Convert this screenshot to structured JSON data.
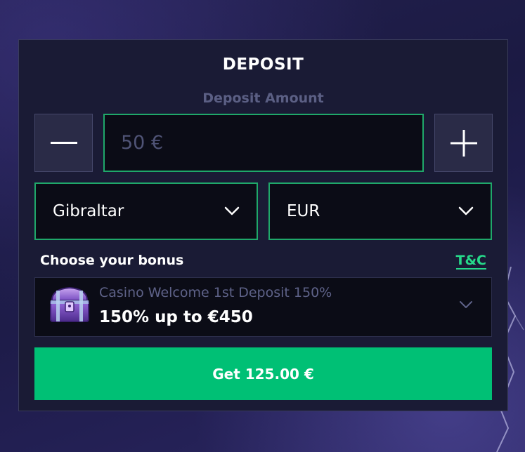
{
  "deposit": {
    "title": "DEPOSIT",
    "amount_label": "Deposit Amount",
    "amount_placeholder": "50 €",
    "minus_icon": "minus-icon",
    "plus_icon": "plus-icon"
  },
  "selects": {
    "country": {
      "value": "Gibraltar",
      "icon": "chevron-down-icon"
    },
    "currency": {
      "value": "EUR",
      "icon": "chevron-down-icon"
    }
  },
  "bonus": {
    "label": "Choose your bonus",
    "terms_link": "T&C",
    "selected": {
      "name": "Casino Welcome 1st Deposit 150%",
      "value": "150% up to €450",
      "icon": "treasure-chest-icon"
    }
  },
  "cta": {
    "label": "Get 125.00 €"
  },
  "colors": {
    "accent": "#00c075",
    "border_green": "#1fa86a",
    "link": "#26d98a",
    "panel": "#1a1b35",
    "field": "#0b0c16"
  }
}
